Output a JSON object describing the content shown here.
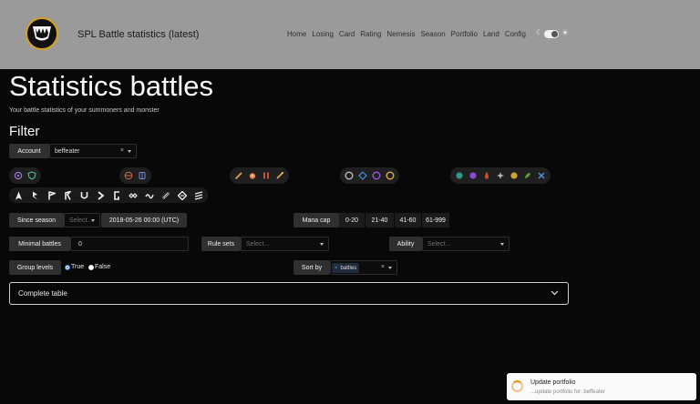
{
  "header": {
    "site_title": "SPL Battle statistics (latest)",
    "nav": [
      "Home",
      "Losing",
      "Card",
      "Rating",
      "Nemesis",
      "Season",
      "Portfolio",
      "Land",
      "Config"
    ],
    "theme_toggle": {
      "moon_icon": "☾",
      "sun_icon": "☀",
      "state": "dark"
    }
  },
  "page": {
    "title": "Statistics battles",
    "subtitle": "Your battle statistics of your summoners and monster",
    "filter_heading": "Filter"
  },
  "filter": {
    "account_label": "Account",
    "account_value": "beffeater",
    "since_season_label": "Since season",
    "since_season_placeholder": "Select...",
    "since_date": "2018-05-26 00:00 (UTC)",
    "mana_cap_label": "Mana cap",
    "mana_cap_options": [
      "0-20",
      "21-40",
      "41-60",
      "61-999"
    ],
    "minimal_battles_label": "Minimal battles",
    "minimal_battles_value": "0",
    "rule_sets_label": "Rule sets",
    "rule_sets_placeholder": "Select...",
    "ability_label": "Ability",
    "ability_placeholder": "Select...",
    "group_levels_label": "Group levels",
    "group_levels_true": "True",
    "group_levels_false": "False",
    "group_levels_selected": "True",
    "sort_by_label": "Sort by",
    "sort_by_tag": "battles"
  },
  "icon_groups": {
    "rarity": [
      "crosshair-icon",
      "shield-icon"
    ],
    "card_type": [
      "monster-icon",
      "summoner-icon"
    ],
    "attack": [
      "melee-icon",
      "fire-icon",
      "ranged-icon",
      "magic-icon"
    ],
    "element": [
      "neutral-ring-icon",
      "water-diamond-icon",
      "death-ring-icon",
      "gold-ring-icon"
    ],
    "splinter": [
      "water-icon",
      "death-icon",
      "fire-icon",
      "dragon-icon",
      "earth-icon",
      "life-icon",
      "water-cross-icon"
    ]
  },
  "accordion": {
    "label": "Complete table"
  },
  "toast": {
    "title": "Update portfolio",
    "message": "...update portfolio for: beffeater"
  },
  "colors": {
    "header_bg": "#9a9a9a",
    "page_bg": "#080808",
    "accent_blue": "#2f7be8",
    "logo_ring": "#d9a21c"
  }
}
